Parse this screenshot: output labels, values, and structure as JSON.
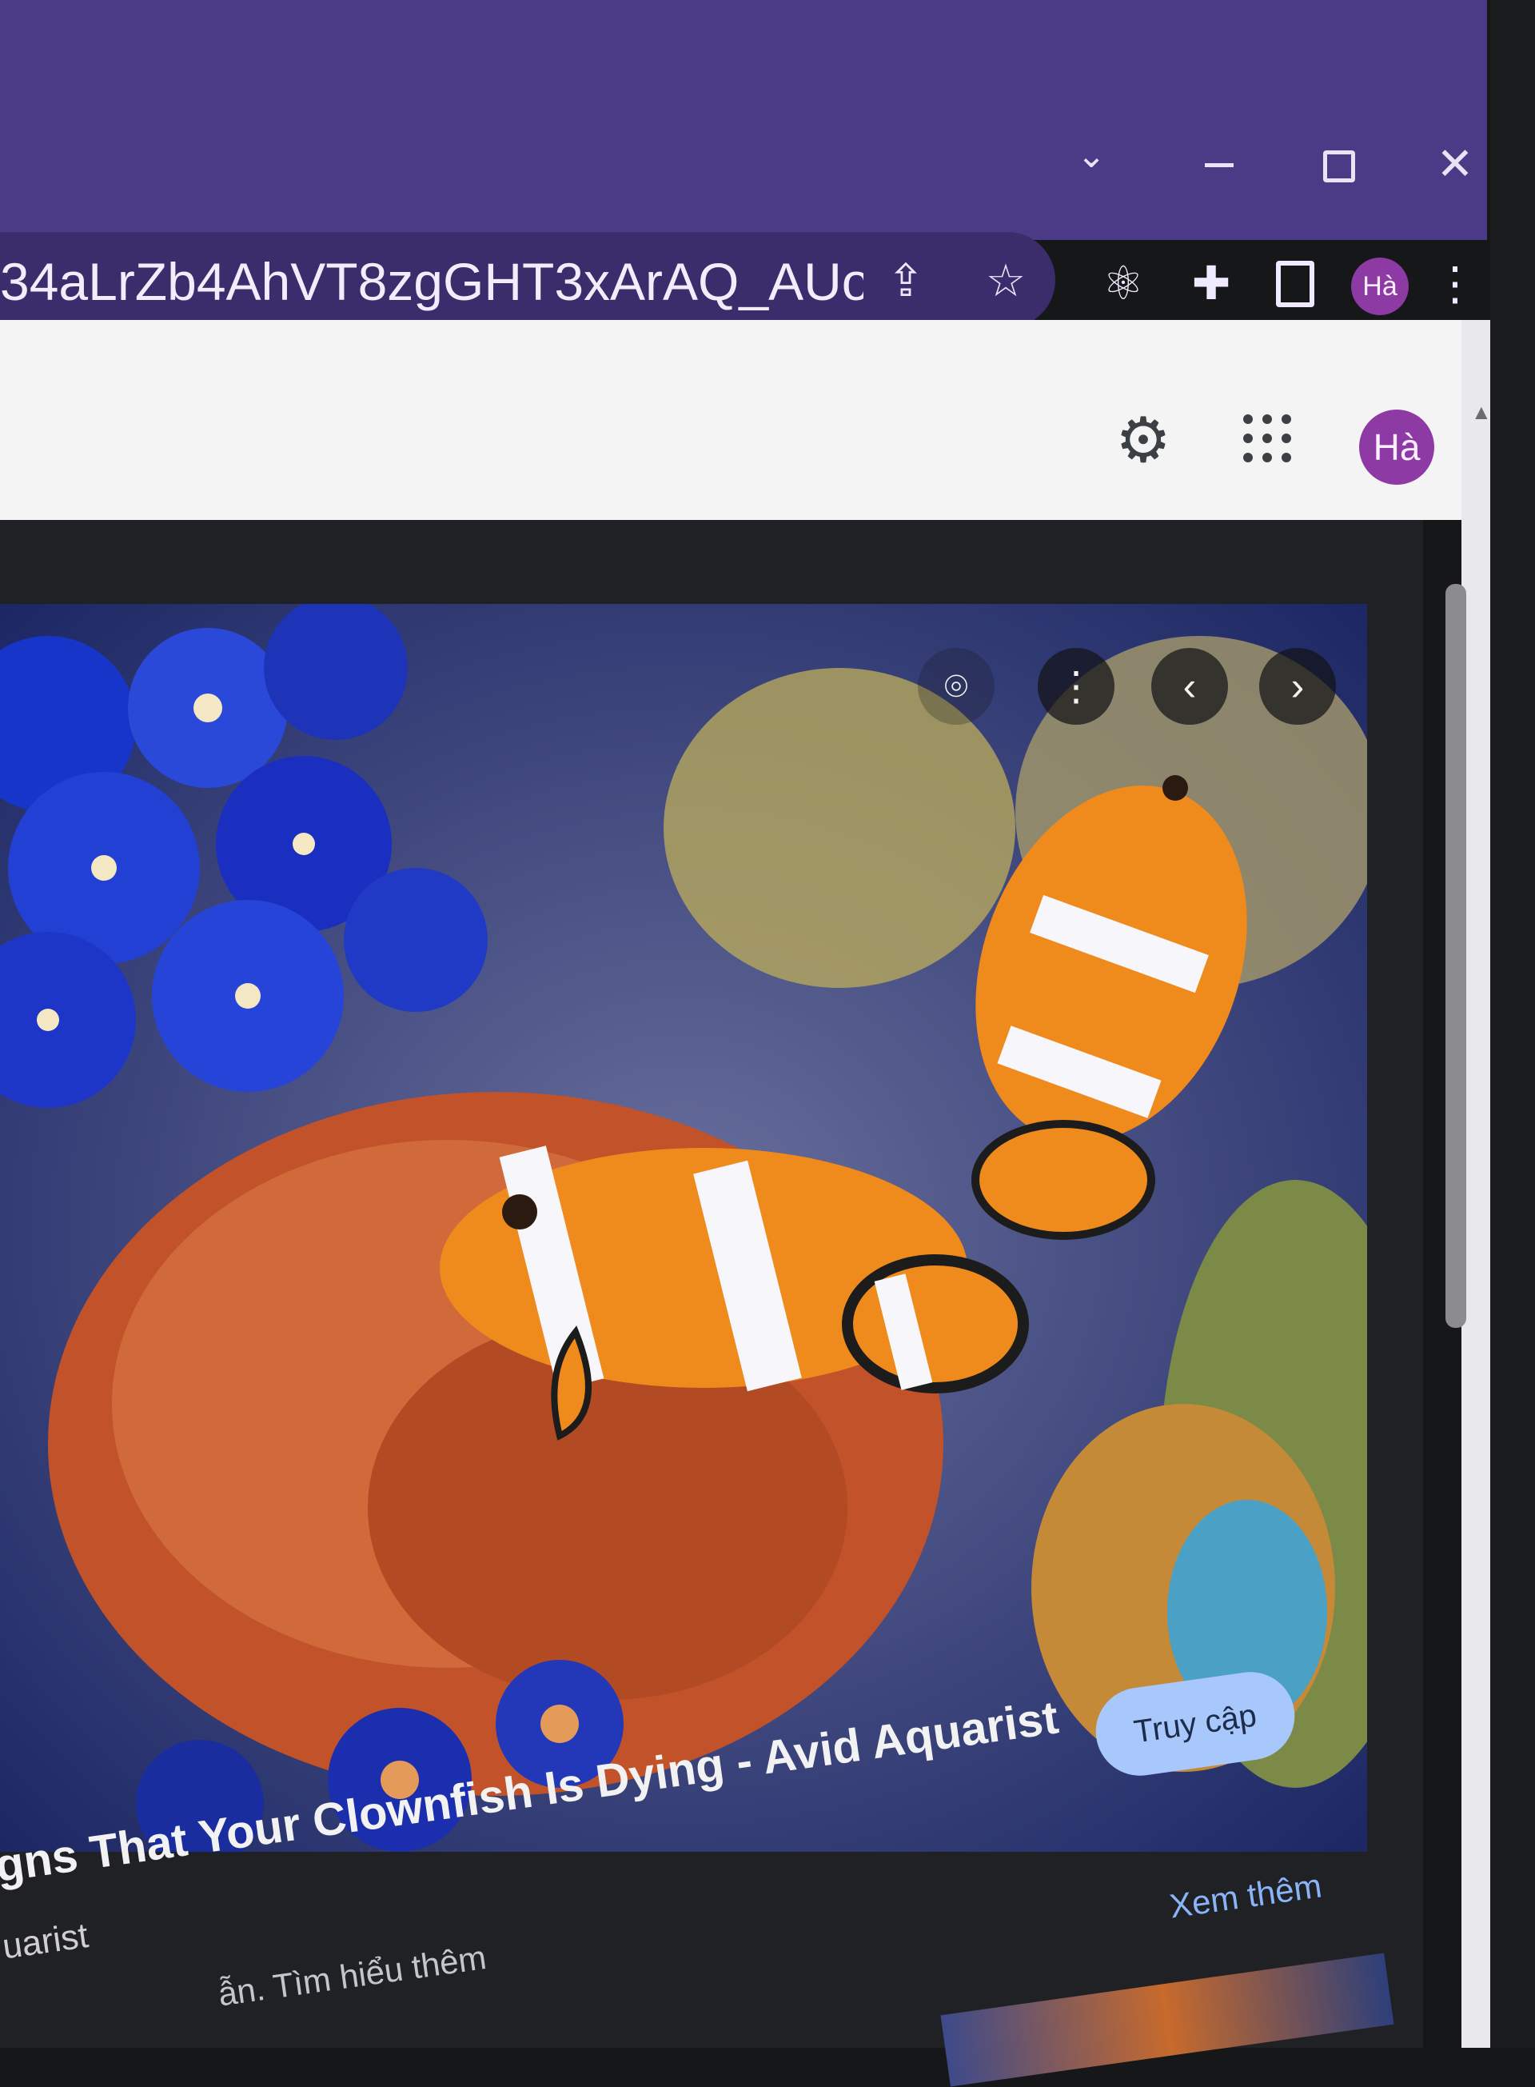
{
  "browser": {
    "url": "34aLrZb4AhVT8zgGHT3xArAQ_AUo...",
    "profile_initial": "Hà",
    "collapse_glyph": "⌄",
    "close_glyph": "✕",
    "share_glyph": "⇪",
    "star_glyph": "☆",
    "atom_glyph": "⚛",
    "puzzle_glyph": "✚",
    "menu_glyph": "⋮"
  },
  "google": {
    "profile_initial": "Hà",
    "settings_glyph": "⚙"
  },
  "viewer": {
    "lens_glyph": "⌾",
    "more_glyph": "⋮",
    "prev_glyph": "‹",
    "next_glyph": "›",
    "visit_label": "Truy cập",
    "title": "gns That Your Clownfish Is Dying - Avid Aquarist",
    "source": "uarist",
    "learn_more": "ẫn. Tìm hiểu thêm",
    "see_more": "Xem thêm"
  },
  "icons": [
    "share-icon",
    "star-icon",
    "atom-icon",
    "puzzle-icon",
    "side-panel-icon",
    "settings-icon",
    "apps-icon",
    "lens-icon",
    "more-icon",
    "chevron-left-icon",
    "chevron-right-icon"
  ],
  "colors": {
    "frame": "#4b3a86",
    "profile": "#8e3aa5",
    "visit_button": "#a8c7fa",
    "see_more_link": "#8ab4f8"
  }
}
